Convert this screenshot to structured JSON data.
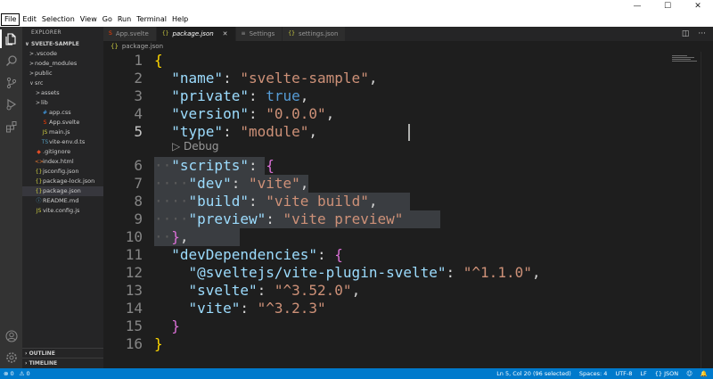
{
  "menu": [
    "File",
    "Edit",
    "Selection",
    "View",
    "Go",
    "Run",
    "Terminal",
    "Help"
  ],
  "window_controls": {
    "minimize": "—",
    "maximize": "☐",
    "close": "✕"
  },
  "activity_icons": [
    "files-icon",
    "search-icon",
    "source-control-icon",
    "run-debug-icon",
    "extensions-icon",
    "account-icon",
    "manage-icon"
  ],
  "sidebar": {
    "title": "EXPLORER",
    "folder": "SVELTE-SAMPLE",
    "items": [
      {
        "label": ".vscode",
        "depth": 0,
        "type": "folder",
        "chev": ">"
      },
      {
        "label": "node_modules",
        "depth": 0,
        "type": "folder",
        "chev": ">"
      },
      {
        "label": "public",
        "depth": 0,
        "type": "folder",
        "chev": ">"
      },
      {
        "label": "src",
        "depth": 0,
        "type": "folder",
        "chev": "∨"
      },
      {
        "label": "assets",
        "depth": 1,
        "type": "folder",
        "chev": ">"
      },
      {
        "label": "lib",
        "depth": 1,
        "type": "folder",
        "chev": ">"
      },
      {
        "label": "app.css",
        "depth": 1,
        "type": "css",
        "chev": ""
      },
      {
        "label": "App.svelte",
        "depth": 1,
        "type": "svelte",
        "chev": ""
      },
      {
        "label": "main.js",
        "depth": 1,
        "type": "js",
        "chev": ""
      },
      {
        "label": "vite-env.d.ts",
        "depth": 1,
        "type": "ts",
        "chev": ""
      },
      {
        "label": ".gitignore",
        "depth": 0,
        "type": "git",
        "chev": ""
      },
      {
        "label": "index.html",
        "depth": 0,
        "type": "html",
        "chev": ""
      },
      {
        "label": "jsconfig.json",
        "depth": 0,
        "type": "json",
        "chev": ""
      },
      {
        "label": "package-lock.json",
        "depth": 0,
        "type": "json",
        "chev": ""
      },
      {
        "label": "package.json",
        "depth": 0,
        "type": "json",
        "chev": "",
        "selected": true
      },
      {
        "label": "README.md",
        "depth": 0,
        "type": "md",
        "chev": ""
      },
      {
        "label": "vite.config.js",
        "depth": 0,
        "type": "js",
        "chev": ""
      }
    ],
    "outline": "OUTLINE",
    "timeline": "TIMELINE"
  },
  "tabs": [
    {
      "label": "App.svelte",
      "icon": "svelte",
      "active": false
    },
    {
      "label": "package.json",
      "icon": "{}",
      "active": true,
      "close": "✕"
    },
    {
      "label": "Settings",
      "icon": "≡",
      "active": false
    },
    {
      "label": "settings.json",
      "icon": "{}",
      "active": false
    }
  ],
  "breadcrumb": {
    "icon": "{}",
    "label": "package.json"
  },
  "editor": {
    "codelens": "Debug",
    "current_line": 5,
    "lines": [
      [
        [
          "{",
          "b1"
        ]
      ],
      [
        [
          "  ",
          "p"
        ],
        [
          "\"name\"",
          "k"
        ],
        [
          ": ",
          "p"
        ],
        [
          "\"svelte-sample\"",
          "s"
        ],
        [
          ",",
          "p"
        ]
      ],
      [
        [
          "  ",
          "p"
        ],
        [
          "\"private\"",
          "k"
        ],
        [
          ": ",
          "p"
        ],
        [
          "true",
          "kw"
        ],
        [
          ",",
          "p"
        ]
      ],
      [
        [
          "  ",
          "p"
        ],
        [
          "\"version\"",
          "k"
        ],
        [
          ": ",
          "p"
        ],
        [
          "\"0.0.0\"",
          "s"
        ],
        [
          ",",
          "p"
        ]
      ],
      [
        [
          "  ",
          "p"
        ],
        [
          "\"type\"",
          "k"
        ],
        [
          ": ",
          "p"
        ],
        [
          "\"module\"",
          "s"
        ],
        [
          ",",
          "p"
        ]
      ],
      [
        [
          "··",
          "dot"
        ],
        [
          "\"scripts\"",
          "k"
        ],
        [
          ": ",
          "p"
        ],
        [
          "{",
          "b2"
        ]
      ],
      [
        [
          "····",
          "dot"
        ],
        [
          "\"dev\"",
          "k"
        ],
        [
          ": ",
          "p"
        ],
        [
          "\"vite\"",
          "s"
        ],
        [
          ",",
          "p"
        ]
      ],
      [
        [
          "····",
          "dot"
        ],
        [
          "\"build\"",
          "k"
        ],
        [
          ": ",
          "p"
        ],
        [
          "\"vite build\"",
          "s"
        ],
        [
          ",",
          "p"
        ]
      ],
      [
        [
          "····",
          "dot"
        ],
        [
          "\"preview\"",
          "k"
        ],
        [
          ": ",
          "p"
        ],
        [
          "\"vite preview\"",
          "s"
        ]
      ],
      [
        [
          "··",
          "dot"
        ],
        [
          "}",
          "b2"
        ],
        [
          ",",
          "p"
        ]
      ],
      [
        [
          "  ",
          "p"
        ],
        [
          "\"devDependencies\"",
          "k"
        ],
        [
          ": ",
          "p"
        ],
        [
          "{",
          "b2"
        ]
      ],
      [
        [
          "    ",
          "p"
        ],
        [
          "\"@sveltejs/vite-plugin-svelte\"",
          "k"
        ],
        [
          ": ",
          "p"
        ],
        [
          "\"^1.1.0\"",
          "s"
        ],
        [
          ",",
          "p"
        ]
      ],
      [
        [
          "    ",
          "p"
        ],
        [
          "\"svelte\"",
          "k"
        ],
        [
          ": ",
          "p"
        ],
        [
          "\"^3.52.0\"",
          "s"
        ],
        [
          ",",
          "p"
        ]
      ],
      [
        [
          "    ",
          "p"
        ],
        [
          "\"vite\"",
          "k"
        ],
        [
          ": ",
          "p"
        ],
        [
          "\"^3.2.3\"",
          "s"
        ]
      ],
      [
        [
          "  ",
          "p"
        ],
        [
          "}",
          "b2"
        ]
      ],
      [
        [
          "}",
          "b1"
        ]
      ]
    ]
  },
  "status": {
    "errors": "⊗ 0",
    "warnings": "⚠ 0",
    "position": "Ln 5, Col 20 (96 selected)",
    "spaces": "Spaces: 4",
    "encoding": "UTF-8",
    "eol": "LF",
    "language": "{} JSON",
    "feedback": "☺",
    "bell": "🔔"
  }
}
